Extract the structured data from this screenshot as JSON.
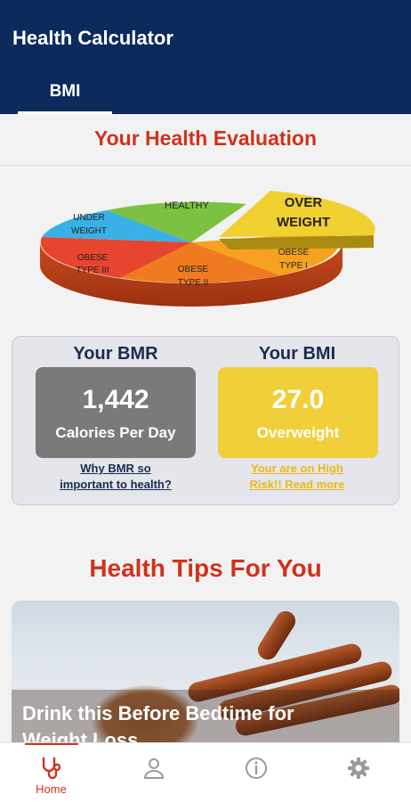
{
  "app": {
    "title": "Health Calculator"
  },
  "tabs": [
    {
      "label": "BMI",
      "active": true
    }
  ],
  "evaluation": {
    "title": "Your Health Evaluation",
    "chart": {
      "segments": [
        {
          "lines": [
            "HEALTHY"
          ],
          "color": "#7cc142"
        },
        {
          "lines": [
            "OVER",
            "WEIGHT"
          ],
          "color": "#f1d130",
          "highlighted": true
        },
        {
          "lines": [
            "OBESE",
            "TYPE I"
          ],
          "color": "#f6a11f"
        },
        {
          "lines": [
            "OBESE",
            "TYPE II"
          ],
          "color": "#ef7a1f"
        },
        {
          "lines": [
            "OBESE",
            "TYPE III"
          ],
          "color": "#e8452e"
        },
        {
          "lines": [
            "UNDER",
            "WEIGHT"
          ],
          "color": "#3ab0e6"
        }
      ]
    }
  },
  "bmr": {
    "heading": "Your BMR",
    "value": "1,442",
    "caption": "Calories Per Day",
    "link_line1": "Why BMR so",
    "link_line2": "important to health?",
    "box_color": "#7a7a7a",
    "link_color": "#1a2b50"
  },
  "bmi": {
    "heading": "Your BMI",
    "value": "27.0",
    "caption": "Overweight",
    "link_line1": "Your are on High",
    "link_line2": "Risk!! Read more",
    "box_color": "#f0cf3a",
    "link_color": "#eab819"
  },
  "tips": {
    "title": "Health Tips For You",
    "card_title_line1": "Drink this Before Bedtime for",
    "card_title_line2": "Weight Loss"
  },
  "nav": [
    {
      "label": "Home",
      "icon": "stethoscope-icon",
      "active": true
    },
    {
      "label": "",
      "icon": "person-icon"
    },
    {
      "label": "",
      "icon": "info-icon"
    },
    {
      "label": "",
      "icon": "gear-icon"
    }
  ],
  "colors": {
    "primary": "#0d2a5c",
    "accent": "#d0321c"
  }
}
